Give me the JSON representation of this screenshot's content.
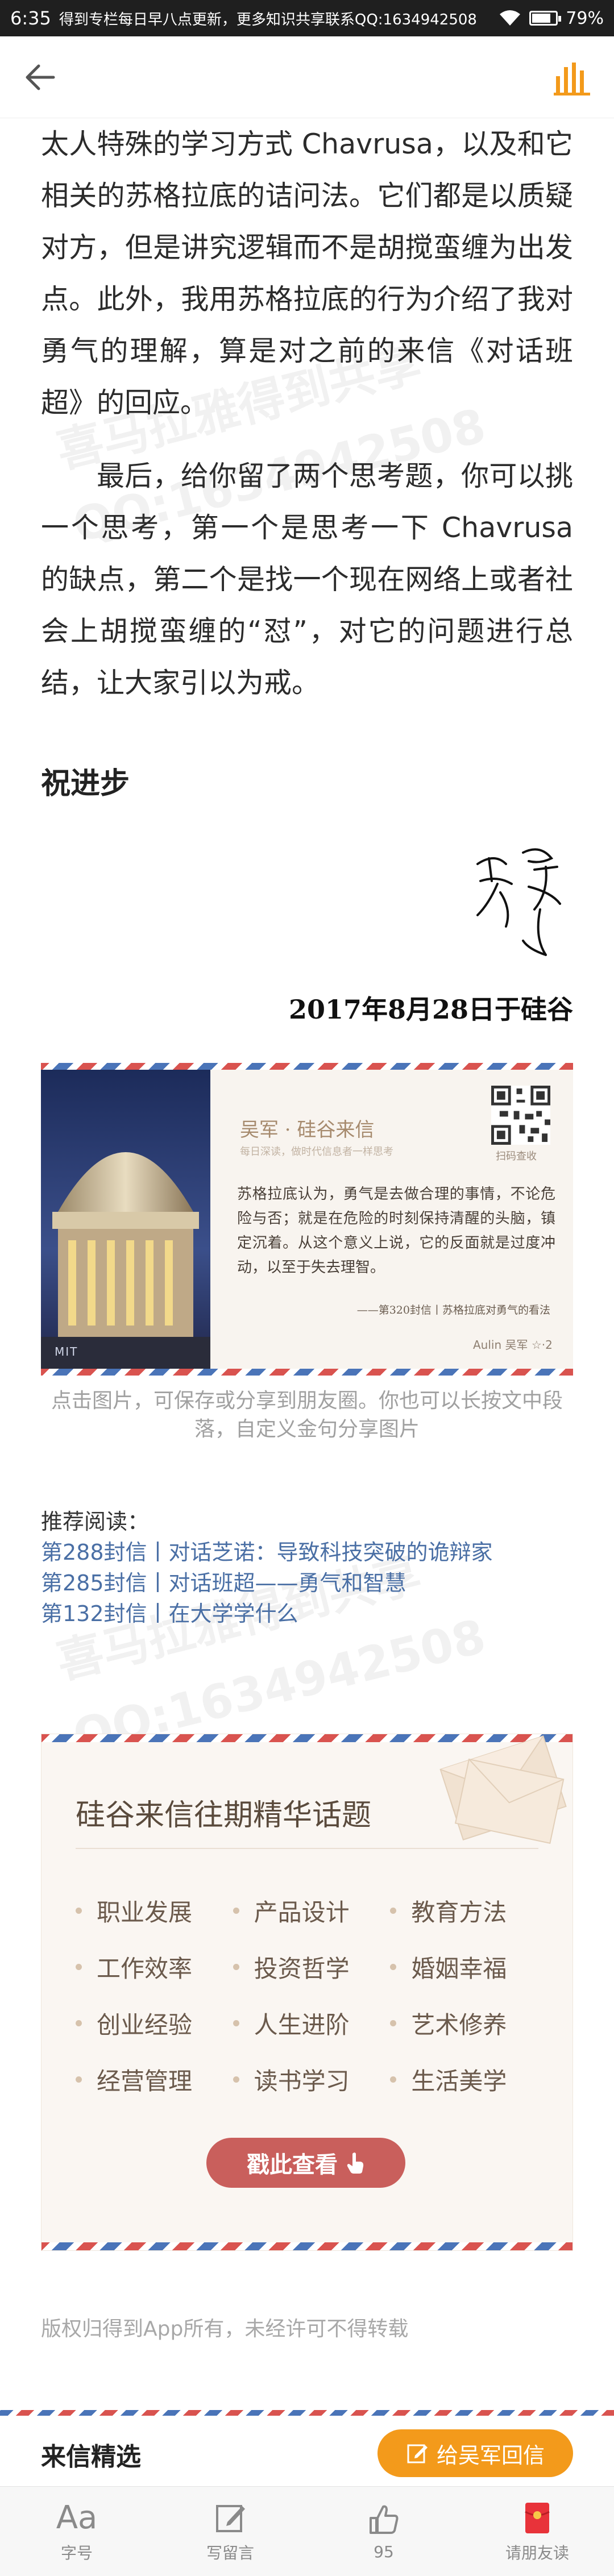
{
  "status_bar": {
    "time": "6:35",
    "notice": "得到专栏每日早八点更新，更多知识共享联系QQ:1634942508",
    "battery": "79%",
    "battery_level": 0.79
  },
  "header": {
    "back_icon": "arrow-left-icon",
    "audio_icon": "audio-bars-icon",
    "accent": "#f39a1b"
  },
  "article": {
    "paragraph1": "太人特殊的学习方式 Chavrusa，以及和它相关的苏格拉底的诘问法。它们都是以质疑对方，但是讲究逻辑而不是胡搅蛮缠为出发点。此外，我用苏格拉底的行为介绍了我对勇气的理解，算是对之前的来信《对话班超》的回应。",
    "paragraph2": "最后，给你留了两个思考题，你可以挑一个思考，第一个是思考一下 Chavrusa 的缺点，第二个是找一个现在网络上或者社会上胡搅蛮缠的“怼”，对它的问题进行总结，让大家引以为戒。",
    "greeting": "祝进步",
    "date": "2017年8月28日于硅谷"
  },
  "quote_card": {
    "title": "吴军 · 硅谷来信",
    "subtitle": "每日深读，做时代信息者一样思考",
    "qr_label": "扫码查收",
    "quote": "苏格拉底认为，勇气是去做合理的事情，不论危险与否；就是在危险的时刻保持清醒的头脑，镇定沉着。从这个意义上说，它的反面就是过度冲动，以至于失去理智。",
    "source": "——第320封信丨苏格拉底对勇气的看法",
    "signature": "Aulin 吴军 ☆·2",
    "photo_label": "MIT"
  },
  "hint": "点击图片，可保存或分享到朋友圈。你也可以长按文中段落，自定义金句分享图片",
  "recommended": {
    "title": "推荐阅读：",
    "links": [
      "第288封信丨对话芝诺：导致科技突破的诡辩家",
      "第285封信丨对话班超——勇气和智慧",
      "第132封信丨在大学学什么"
    ]
  },
  "topics": {
    "title": "硅谷来信往期精华话题",
    "items": [
      "职业发展",
      "产品设计",
      "教育方法",
      "工作效率",
      "投资哲学",
      "婚姻幸福",
      "创业经验",
      "人生进阶",
      "艺术修养",
      "经营管理",
      "读书学习",
      "生活美学"
    ],
    "button": "戳此查看"
  },
  "copyright": "版权归得到App所有，未经许可不得转载",
  "letters_bar": {
    "title": "来信精选",
    "reply_button": "给吴军回信"
  },
  "tabbar": {
    "font_label": "字号",
    "comment_label": "写留言",
    "like_count": "95",
    "invite_label": "请朋友读"
  },
  "watermark": {
    "line1": "喜马拉雅得到共享",
    "line2": "QQ:1634942508"
  }
}
